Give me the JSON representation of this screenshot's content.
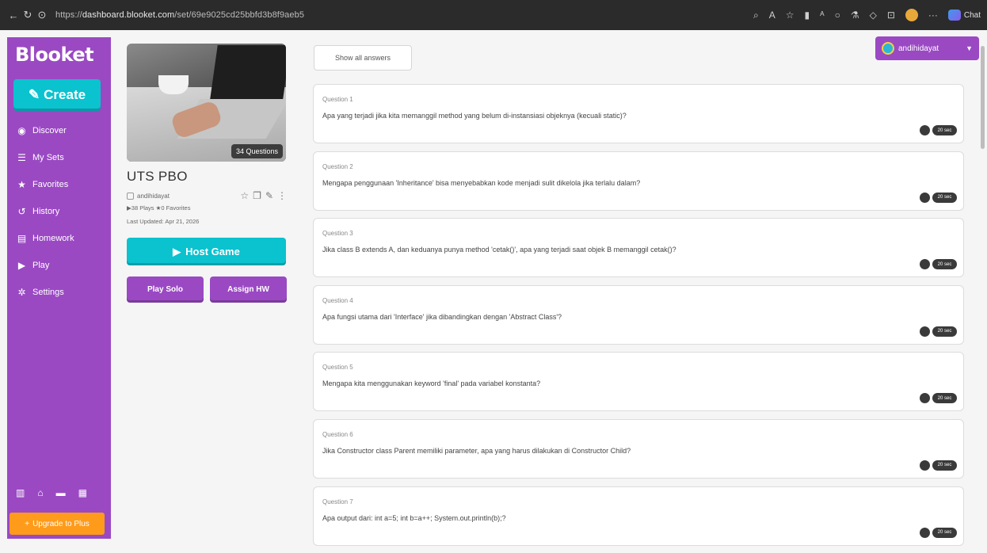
{
  "browser": {
    "url_prefix": "https://",
    "url_host": "dashboard.blooket.com",
    "url_path": "/set/69e9025cd25bbfd3b8f9aeb5",
    "chat_label": "Chat"
  },
  "sidebar": {
    "logo": "Blooket",
    "create_label": "Create",
    "items": [
      {
        "label": "Discover",
        "icon": "compass-icon"
      },
      {
        "label": "My Sets",
        "icon": "list-icon"
      },
      {
        "label": "Favorites",
        "icon": "star-icon"
      },
      {
        "label": "History",
        "icon": "history-icon"
      },
      {
        "label": "Homework",
        "icon": "clipboard-icon"
      },
      {
        "label": "Play",
        "icon": "play-icon"
      },
      {
        "label": "Settings",
        "icon": "gear-icon"
      }
    ],
    "upgrade_label": "Upgrade to Plus"
  },
  "set": {
    "questions_badge": "34 Questions",
    "title": "UTS PBO",
    "author": "andihidayat",
    "stats": "▶38 Plays  ★0 Favorites",
    "updated": "Last Updated: Apr 21, 2026",
    "host_label": "Host Game",
    "play_solo_label": "Play Solo",
    "assign_hw_label": "Assign HW"
  },
  "questions_header": {
    "show_all_label": "Show all answers",
    "username": "andihidayat"
  },
  "questions": [
    {
      "label": "Question 1",
      "text": "Apa yang terjadi jika kita memanggil method yang belum di-instansiasi objeknya (kecuali static)?",
      "time": "20 sec"
    },
    {
      "label": "Question 2",
      "text": "Mengapa penggunaan 'Inheritance' bisa menyebabkan kode menjadi sulit dikelola jika terlalu dalam?",
      "time": "20 sec"
    },
    {
      "label": "Question 3",
      "text": "Jika class B extends A, dan keduanya punya method 'cetak()', apa yang terjadi saat objek B memanggil cetak()?",
      "time": "20 sec"
    },
    {
      "label": "Question 4",
      "text": "Apa fungsi utama dari 'Interface' jika dibandingkan dengan 'Abstract Class'?",
      "time": "20 sec"
    },
    {
      "label": "Question 5",
      "text": "Mengapa kita menggunakan keyword 'final' pada variabel konstanta?",
      "time": "20 sec"
    },
    {
      "label": "Question 6",
      "text": "Jika Constructor class Parent memiliki parameter, apa yang harus dilakukan di Constructor Child?",
      "time": "20 sec"
    },
    {
      "label": "Question 7",
      "text": "Apa output dari: int a=5; int b=a++; System.out.println(b);?",
      "time": "20 sec"
    }
  ]
}
